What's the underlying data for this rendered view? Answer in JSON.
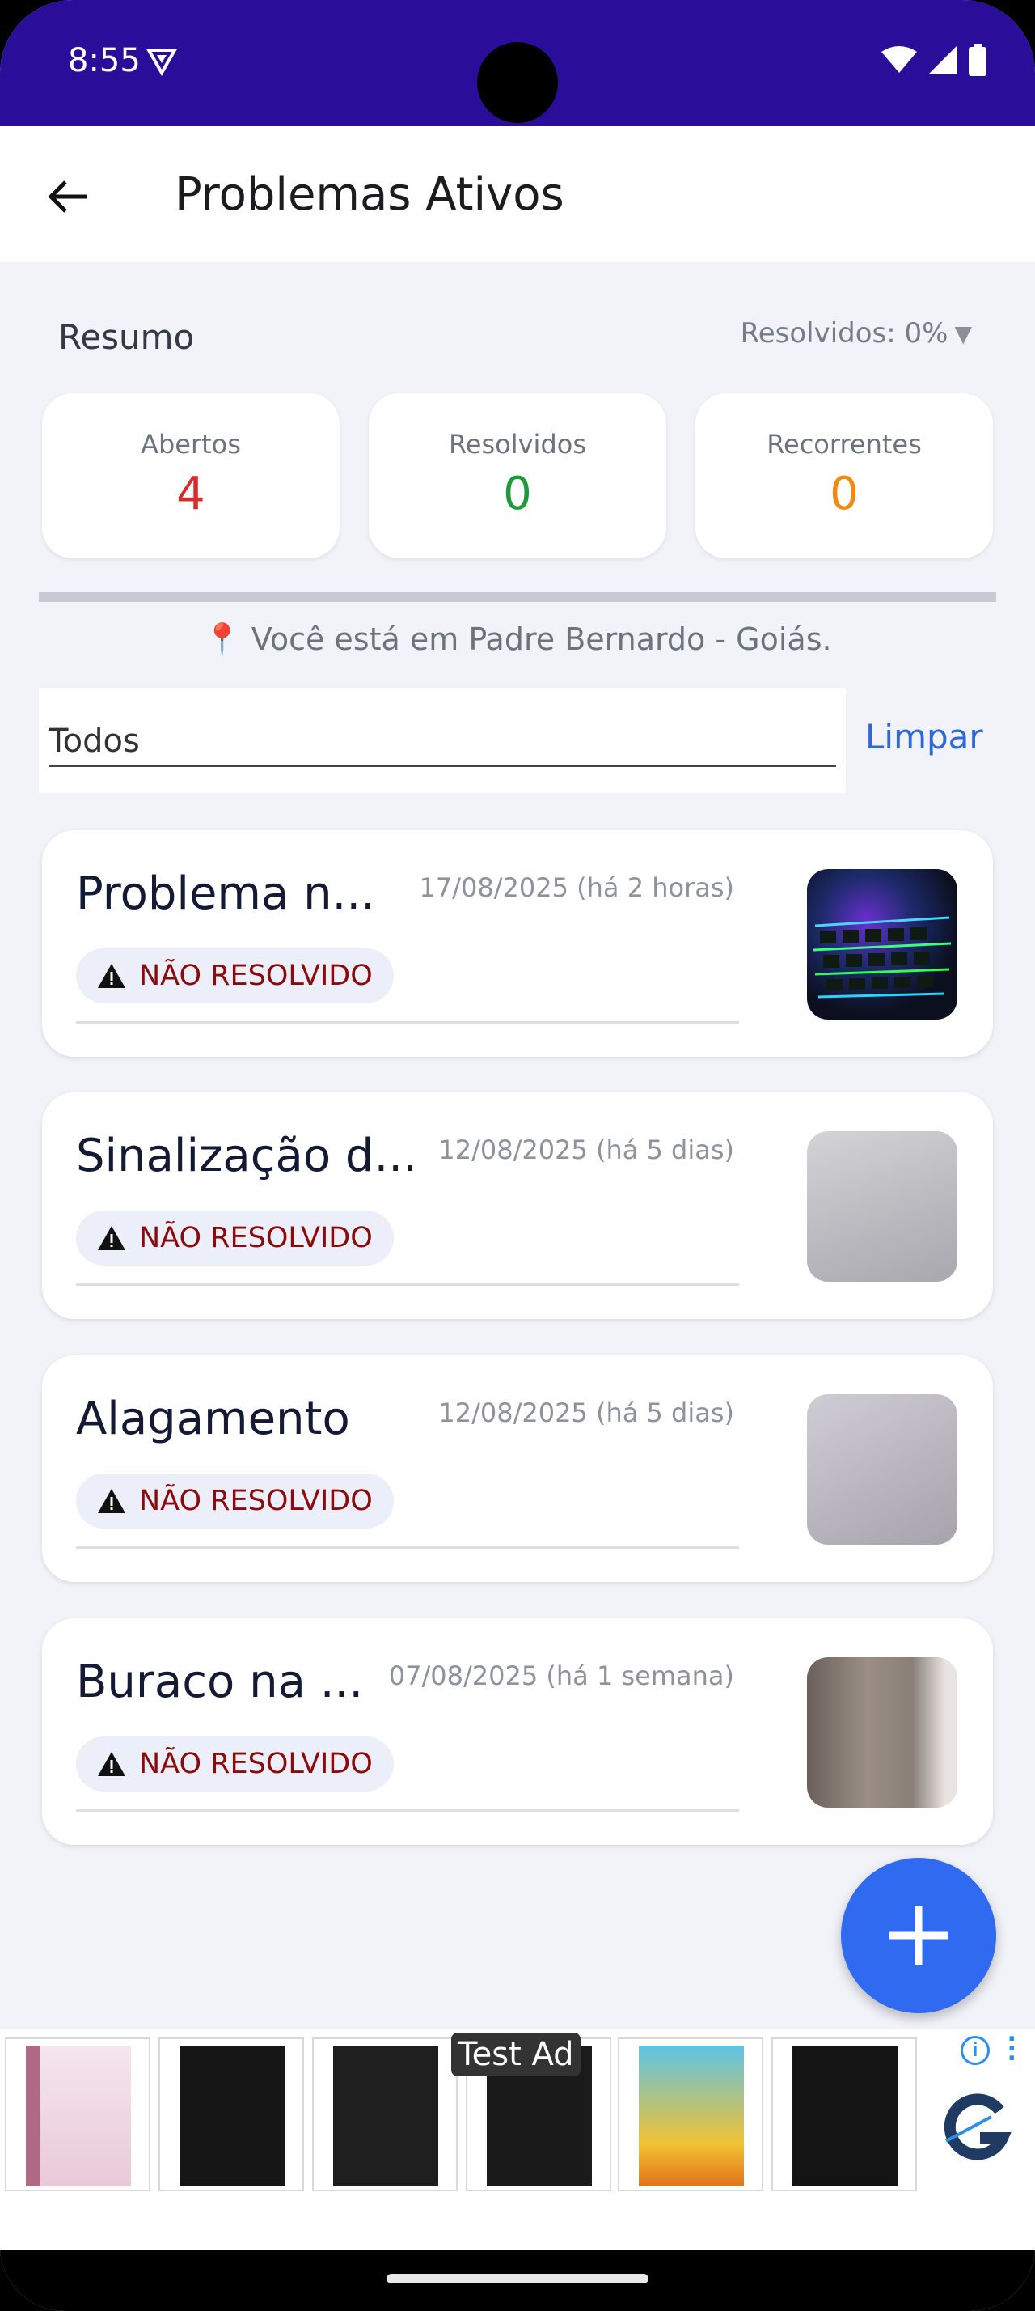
{
  "status_bar": {
    "time": "8:55"
  },
  "app_bar": {
    "title": "Problemas Ativos"
  },
  "summary": {
    "label": "Resumo",
    "filter_label": "Resolvidos: 0%",
    "stats": [
      {
        "label": "Abertos",
        "value": "4",
        "color": "#d92b2b"
      },
      {
        "label": "Resolvidos",
        "value": "0",
        "color": "#1f9a3a"
      },
      {
        "label": "Recorrentes",
        "value": "0",
        "color": "#f08a12"
      }
    ]
  },
  "location": "📍 Você está em Padre Bernardo - Goiás.",
  "filter": {
    "value": "Todos",
    "clear_label": "Limpar"
  },
  "problems": [
    {
      "title": "Problema n...",
      "date": "17/08/2025 (há 2 horas)",
      "status": "NÃO RESOLVIDO"
    },
    {
      "title": "Sinalização d...",
      "date": "12/08/2025 (há 5 dias)",
      "status": "NÃO RESOLVIDO"
    },
    {
      "title": "Alagamento",
      "date": "12/08/2025 (há 5 dias)",
      "status": "NÃO RESOLVIDO"
    },
    {
      "title": "Buraco na ...",
      "date": "07/08/2025 (há 1 semana)",
      "status": "NÃO RESOLVIDO"
    }
  ],
  "ad": {
    "tag": "Test Ad"
  },
  "colors": {
    "accent": "#2f6af0",
    "status_bar": "#2a0e9a",
    "unresolved": "#8b0b0b"
  }
}
